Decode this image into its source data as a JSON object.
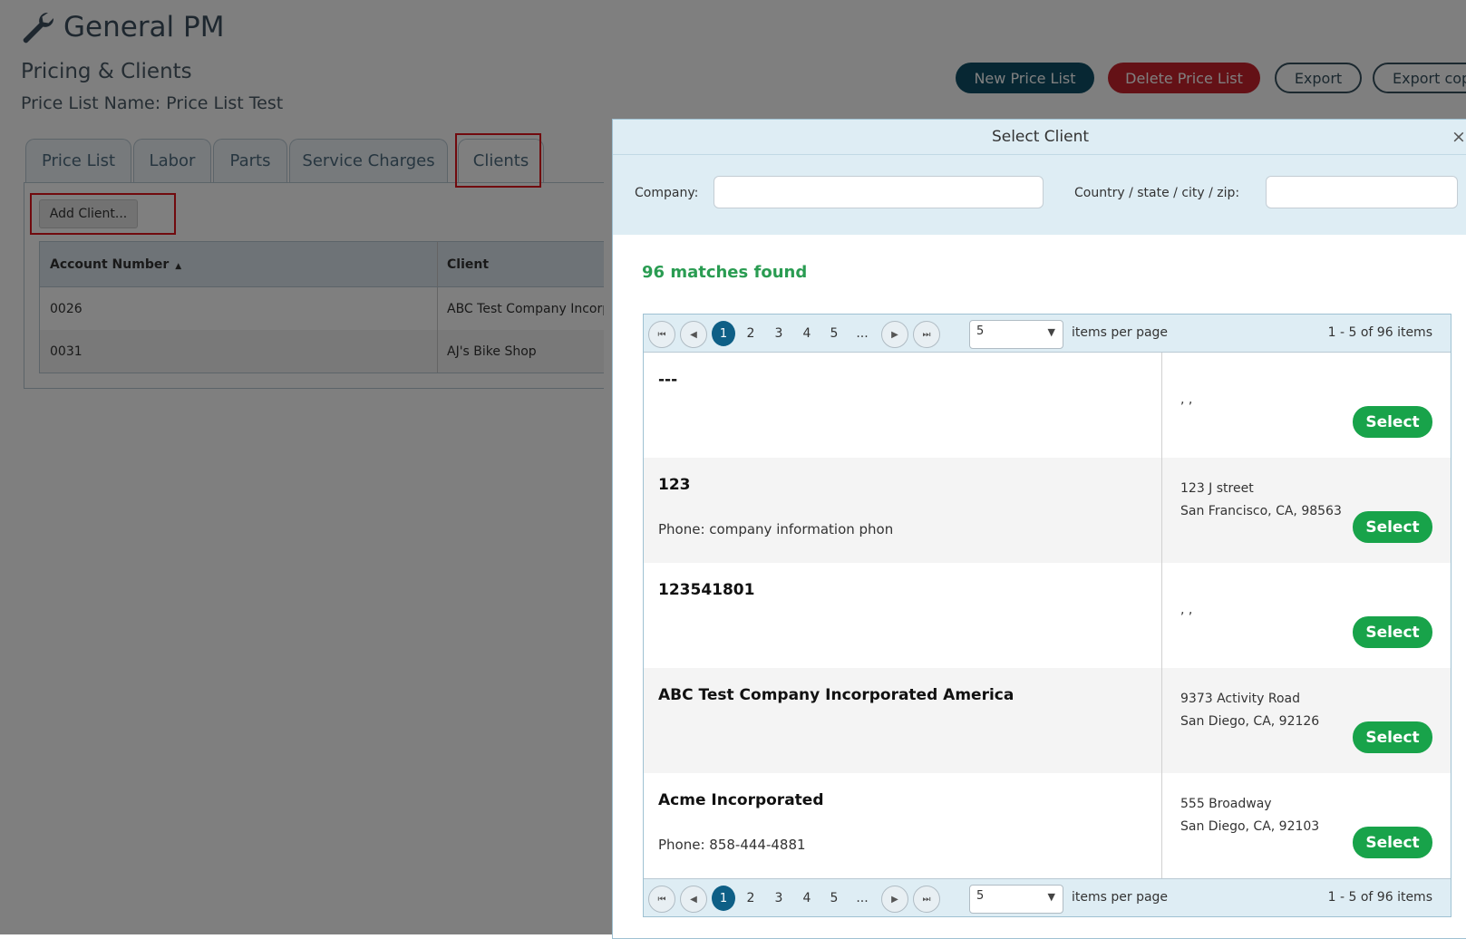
{
  "app": {
    "title": "General PM",
    "subtitle": "Pricing & Clients",
    "price_list_name": "Price List Name: Price List Test"
  },
  "toolbar": {
    "new_price_list": "New Price List",
    "delete_price_list": "Delete Price List",
    "export": "Export",
    "export_copy": "Export cop"
  },
  "tabs": [
    {
      "label": "Price List",
      "active": false
    },
    {
      "label": "Labor",
      "active": false
    },
    {
      "label": "Parts",
      "active": false
    },
    {
      "label": "Service Charges",
      "active": false
    },
    {
      "label": "Clients",
      "active": true
    }
  ],
  "clients_tab": {
    "add_client_label": "Add Client...",
    "columns": [
      "Account Number",
      "Client"
    ],
    "sort_indicator": "▲",
    "rows": [
      {
        "account": "0026",
        "client": "ABC Test Company Incorp"
      },
      {
        "account": "0031",
        "client": "AJ's Bike Shop"
      }
    ]
  },
  "modal": {
    "title": "Select Client",
    "close": "×",
    "company_label": "Company:",
    "company_value": "",
    "location_label": "Country / state / city / zip:",
    "location_value": "",
    "matches": "96 matches found",
    "pager": {
      "first": "⏮",
      "prev": "◀",
      "next": "▶",
      "last": "⏭",
      "pages": [
        "1",
        "2",
        "3",
        "4",
        "5",
        "..."
      ],
      "current_page": "1",
      "page_size": "5",
      "items_per_page_label": "items per page",
      "info": "1 - 5 of 96 items"
    },
    "select_label": "Select",
    "results": [
      {
        "name": "---",
        "phone": "",
        "address_line1": "",
        "address_line2": ", ,"
      },
      {
        "name": "123",
        "phone": "Phone: company information phon",
        "address_line1": "123 J street",
        "address_line2": "San Francisco, CA, 98563"
      },
      {
        "name": "123541801",
        "phone": "",
        "address_line1": "",
        "address_line2": ", ,"
      },
      {
        "name": "ABC Test Company Incorporated America",
        "phone": "",
        "address_line1": "9373 Activity Road",
        "address_line2": "San Diego, CA, 92126"
      },
      {
        "name": "Acme Incorporated",
        "phone": "Phone: 858-444-4881",
        "address_line1": "555 Broadway",
        "address_line2": "San Diego, CA, 92103"
      }
    ]
  },
  "colors": {
    "accent_dark": "#0e4f66",
    "danger": "#c8232d",
    "success": "#18a34a",
    "highlight": "#e3141c"
  },
  "icons": {
    "app": "wrench-icon",
    "search": "search-icon"
  }
}
